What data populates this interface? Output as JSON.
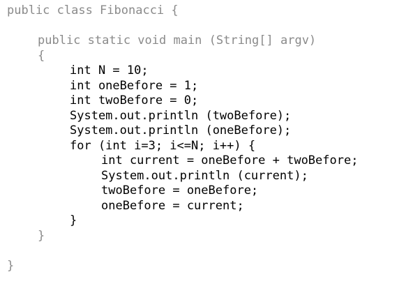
{
  "code": {
    "lines": [
      "public class Fibonacci {",
      "",
      "public static void main (String[] argv)",
      "{",
      "int N = 10;",
      "int oneBefore = 1;",
      "int twoBefore = 0;",
      "System.out.println (twoBefore);",
      "System.out.println (oneBefore);",
      "for (int i=3; i<=N; i++) {",
      "int current = oneBefore + twoBefore;",
      "System.out.println (current);",
      "twoBefore = oneBefore;",
      "oneBefore = current;",
      "}",
      "}",
      "",
      "}"
    ]
  }
}
